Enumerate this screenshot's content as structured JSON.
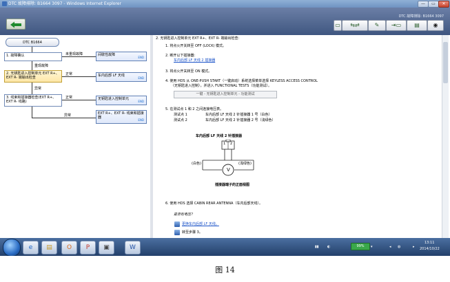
{
  "window": {
    "title": "DTC 故障排除: B1664 3097 - Windows Internet Explorer",
    "min_label": "—",
    "max_label": "▭",
    "close_label": "✕"
  },
  "header": {
    "dtc_label": "DTC 故障排除: B1664 3097"
  },
  "flow": {
    "title_box": "DTC B1664",
    "box1_num": "1.",
    "box1_text": "故障确认",
    "box1_label_right": "未重现故障",
    "box1_result": "间歇性故障",
    "box1_label_down": "重现故障",
    "box2_num": "2.",
    "box2_text": "无钥匙进入控制单元 EXT R+、EXT R- 端输出检查",
    "box2_label_right": "正常",
    "box2_result": "车内后部 LF 天线",
    "box2_label_down": "异常",
    "box3_num": "3.",
    "box3_text": "线束和插接器检查(EXT R+、EXT R- 线路)",
    "box3_label_right": "正常",
    "box3_result": "无钥匙进入控制单元",
    "box3_label_down": "异常",
    "box4_result": "EXT R+、EXT R- 线束和插接器",
    "sel": "END"
  },
  "content": {
    "heading": "2. 无钥匙进入控制单元 EXT R+、EXT R- 端输出检查：",
    "step1": "1. 将点火开关转至 OFF (LOCK) 模式。",
    "step2": "2. 断开以下插接器：",
    "step2_link": "车内后部 LF 天线 2 插接器",
    "step3": "3. 将点火开关转至 ON 模式。",
    "step4_line1": "4. 使用 HDS 从 ONE-PUSH START（一键启动）系统选择菜单选择 KEYLESS ACCESS CONTROL",
    "step4_line2": "（无钥匙进入控制），并进入 FUNCTIONAL TESTS（功能测试）。",
    "step4_button": "一键 - 无钥匙进入控制单元 - 功能测试",
    "step5": "5. 在测试点 1 和 2 之间连接电压表。",
    "tp1_label": "测试点 1",
    "tp1_value": "车内后部 LF 天线 2 针插接器 1 号（白色）",
    "tp2_label": "测试点 2",
    "tp2_value": "车内后部 LF 天线 2 针插接器 2 号（浅绿色）",
    "diagram_title": "车内后部 LF 天线 2 针插接器",
    "pin1": "1",
    "pin2": "2",
    "white_label": "(白色)",
    "lgreen_label": "(浅绿色)",
    "meter_symbol": "V",
    "diagram_caption": "插接器端子的正面视图",
    "step6": "6. 使用 HDS 选择 CABIN REAR ANTENNA（车内后部天线）。",
    "question": "是否有电压？",
    "yes_link": "更换车内后部 LF 天线。",
    "no_text": "转至步骤 3。"
  },
  "taskbar": {
    "zoom": "99%",
    "time": "13:11",
    "date": "2014/10/22"
  },
  "caption": "图  14"
}
